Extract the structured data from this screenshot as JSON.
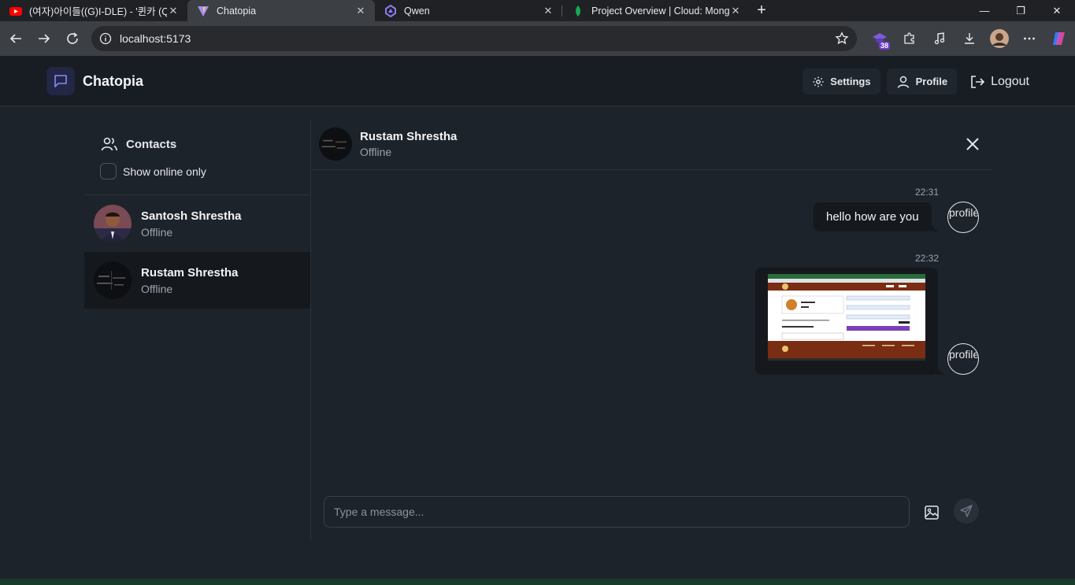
{
  "browser": {
    "tabs": [
      {
        "title": "(여자)아이들((G)I-DLE) - '퀸카 (Qu",
        "icon": "youtube-icon"
      },
      {
        "title": "Chatopia",
        "icon": "vite-icon",
        "active": true
      },
      {
        "title": "Qwen",
        "icon": "qwen-icon"
      },
      {
        "title": "Project Overview | Cloud: MongoDB",
        "icon": "mongodb-leaf-icon"
      }
    ],
    "url": "localhost:5173",
    "extension_badge": "38"
  },
  "app": {
    "brand": "Chatopia",
    "nav": {
      "settings": "Settings",
      "profile": "Profile",
      "logout": "Logout"
    }
  },
  "sidebar": {
    "title": "Contacts",
    "online_only_label": "Show online only",
    "contacts": [
      {
        "name": "Santosh Shrestha",
        "status": "Offline"
      },
      {
        "name": "Rustam Shrestha",
        "status": "Offline"
      }
    ]
  },
  "chat": {
    "contact_name": "Rustam Shrestha",
    "contact_status": "Offline",
    "messages": [
      {
        "time": "22:31",
        "text": "hello how are you",
        "avatar_alt": "profile"
      },
      {
        "time": "22:32",
        "image": "screenshot-attachment",
        "avatar_alt": "profile"
      }
    ],
    "input_placeholder": "Type a message..."
  },
  "colors": {
    "accent": "#6366f1",
    "background": "#1d232a",
    "bubble": "#15191e"
  }
}
